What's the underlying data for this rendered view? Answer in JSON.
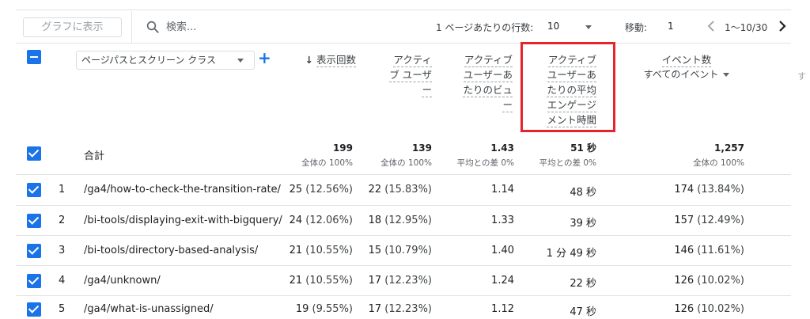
{
  "toolbar": {
    "graph_button": "グラフに表示",
    "search_placeholder": "検索...",
    "rows_per_page_label": "1 ページあたりの行数:",
    "rows_per_page_value": "10",
    "move_label": "移動:",
    "move_value": "1",
    "page_range": "1〜10/30"
  },
  "header": {
    "dimension_select": "ページパスとスクリーン クラス",
    "add_dimension": "+",
    "columns": {
      "views": {
        "arrow": "↓",
        "label": "表示回数"
      },
      "active_users": {
        "lines": [
          "アクティ",
          "ブ ユーザ",
          "ー"
        ]
      },
      "views_per_user": {
        "lines": [
          "アクティブ",
          "ユーザーあ",
          "たりのビュ",
          "ー"
        ]
      },
      "engagement_time": {
        "lines": [
          "アクティブ",
          "ユーザーあ",
          "たりの平均",
          "エンゲージ",
          "メント時間"
        ]
      },
      "events": {
        "label": "イベント数",
        "sub": "すべてのイベント"
      },
      "next_col_hint": "す"
    }
  },
  "totals": {
    "label": "合計",
    "views": "199",
    "views_sub": "全体の 100%",
    "active_users": "139",
    "active_users_sub": "全体の 100%",
    "views_per_user": "1.43",
    "views_per_user_sub": "平均との差 0%",
    "engagement_time": "51 秒",
    "engagement_time_sub": "平均との差 0%",
    "events": "1,257",
    "events_sub": "全体の 100%"
  },
  "rows": [
    {
      "idx": "1",
      "path": "/ga4/how-to-check-the-transition-rate/",
      "views": "25",
      "views_pct": "(12.56%)",
      "active_users": "22",
      "active_users_pct": "(15.83%)",
      "views_per_user": "1.14",
      "engagement_time": "48 秒",
      "events": "174",
      "events_pct": "(13.84%)"
    },
    {
      "idx": "2",
      "path": "/bi-tools/displaying-exit-with-bigquery/",
      "views": "24",
      "views_pct": "(12.06%)",
      "active_users": "18",
      "active_users_pct": "(12.95%)",
      "views_per_user": "1.33",
      "engagement_time": "39 秒",
      "events": "157",
      "events_pct": "(12.49%)"
    },
    {
      "idx": "3",
      "path": "/bi-tools/directory-based-analysis/",
      "views": "21",
      "views_pct": "(10.55%)",
      "active_users": "15",
      "active_users_pct": "(10.79%)",
      "views_per_user": "1.40",
      "engagement_time": "1 分 49 秒",
      "events": "146",
      "events_pct": "(11.61%)"
    },
    {
      "idx": "4",
      "path": "/ga4/unknown/",
      "views": "21",
      "views_pct": "(10.55%)",
      "active_users": "17",
      "active_users_pct": "(12.23%)",
      "views_per_user": "1.24",
      "engagement_time": "22 秒",
      "events": "126",
      "events_pct": "(10.02%)"
    },
    {
      "idx": "5",
      "path": "/ga4/what-is-unassigned/",
      "views": "19",
      "views_pct": "(9.55%)",
      "active_users": "17",
      "active_users_pct": "(12.23%)",
      "views_per_user": "1.12",
      "engagement_time": "47 秒",
      "events": "126",
      "events_pct": "(10.02%)"
    }
  ],
  "colors": {
    "accent": "#1a73e8",
    "highlight": "#e8242b"
  }
}
